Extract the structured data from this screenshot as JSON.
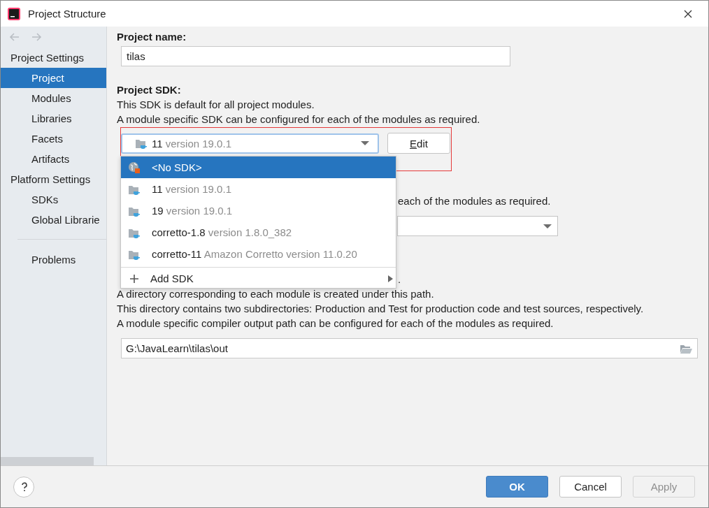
{
  "window": {
    "title": "Project Structure"
  },
  "sidebar": {
    "sections": [
      {
        "title": "Project Settings",
        "items": [
          {
            "label": "Project",
            "selected": true
          },
          {
            "label": "Modules",
            "selected": false
          },
          {
            "label": "Libraries",
            "selected": false
          },
          {
            "label": "Facets",
            "selected": false
          },
          {
            "label": "Artifacts",
            "selected": false
          }
        ]
      },
      {
        "title": "Platform Settings",
        "items": [
          {
            "label": "SDKs",
            "selected": false
          },
          {
            "label": "Global Librarie",
            "selected": false
          }
        ]
      }
    ],
    "footer_items": [
      {
        "label": "Problems",
        "selected": false
      }
    ]
  },
  "project_name": {
    "label": "Project name:",
    "value": "tilas"
  },
  "project_sdk": {
    "label": "Project SDK:",
    "description": [
      "This SDK is default for all project modules.",
      "A module specific SDK can be configured for each of the modules as required."
    ],
    "combo": {
      "name": "11",
      "detail": "version 19.0.1"
    },
    "edit_button": "Edit"
  },
  "language_level": {
    "visible_text": "each of the modules as required."
  },
  "compiler_output": {
    "visible_text": ".",
    "lines": [
      "A directory corresponding to each module is created under this path.",
      "This directory contains two subdirectories: Production and Test for production code and test sources, respectively.",
      "A module specific compiler output path can be configured for each of the modules as required."
    ],
    "value": "G:\\JavaLearn\\tilas\\out"
  },
  "sdk_popup": {
    "items": [
      {
        "kind": "none",
        "name": "<No SDK>",
        "selected": true
      },
      {
        "kind": "jdk",
        "name": "11",
        "detail": "version 19.0.1",
        "selected": false
      },
      {
        "kind": "jdk",
        "name": "19",
        "detail": "version 19.0.1",
        "selected": false
      },
      {
        "kind": "jdk",
        "name": "corretto-1.8",
        "detail": "version 1.8.0_382",
        "selected": false
      },
      {
        "kind": "jdk",
        "name": "corretto-11",
        "detail": "Amazon Corretto version 11.0.20",
        "selected": false
      }
    ],
    "action": {
      "label": "Add SDK",
      "has_submenu": true
    }
  },
  "buttons": [
    {
      "label": "OK",
      "kind": "primary",
      "disabled": false
    },
    {
      "label": "Cancel",
      "kind": "normal",
      "disabled": false
    },
    {
      "label": "Apply",
      "kind": "normal",
      "disabled": true
    }
  ]
}
